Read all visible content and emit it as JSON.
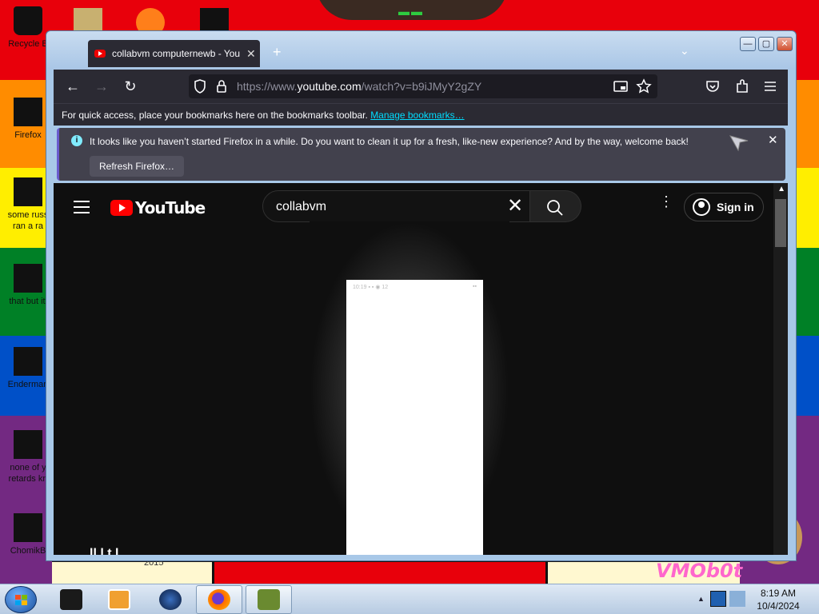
{
  "desktop": {
    "icons": [
      {
        "label": "Recycle B"
      },
      {
        "label": "Firefox"
      },
      {
        "label": "some russ\nran a ra"
      },
      {
        "label": "that but it'"
      },
      {
        "label": "Enderman"
      },
      {
        "label": "none of y\nretards kn"
      },
      {
        "label": "ChomikB"
      }
    ],
    "year_text": "2015",
    "logo_text": "VMOb0t"
  },
  "window": {
    "buttons": {
      "minimize": "—",
      "maximize": "▢",
      "close": "✕"
    },
    "tab": {
      "title": "collabvm computernewb - You",
      "close": "✕"
    },
    "new_tab": "+",
    "tab_list": "⌄"
  },
  "navbar": {
    "back": "←",
    "forward": "→",
    "reload": "↻",
    "url_prefix": "https://www.",
    "url_domain": "youtube.com",
    "url_suffix": "/watch?v=b9iJMyY2gZY",
    "icons": [
      "shield-icon",
      "lock-icon",
      "picture-in-picture-icon",
      "bookmark-star-icon",
      "pocket-icon",
      "extensions-icon",
      "menu-icon"
    ]
  },
  "bookmarks_bar": {
    "text": "For quick access, place your bookmarks here on the bookmarks toolbar. ",
    "link": "Manage bookmarks…"
  },
  "notification": {
    "message": "It looks like you haven’t started Firefox in a while. Do you want to clean it up for a fresh, like-new experience? And by the way, welcome back!",
    "button": "Refresh Firefox…",
    "close": "✕"
  },
  "youtube": {
    "logo_text": "YouTube",
    "search_value": "collabvm",
    "search_clear": "✕",
    "more": "⋮",
    "signin": "Sign in",
    "video_status_left": "10:19 ▪ ▪ ◉ 12",
    "video_status_right": "▪▪",
    "title_peek": "ll  l         t     l"
  },
  "taskbar": {
    "items": [
      "terminal-icon",
      "media-player-icon",
      "browser-globe-icon",
      "firefox-icon",
      "chomikbox-icon"
    ],
    "active_index": 3,
    "clock_time": "8:19 AM",
    "clock_date": "10/4/2024"
  },
  "colors": {
    "firefox_dark": "#2b2a33",
    "youtube_bg": "#0f0f0f",
    "youtube_red": "#ff0000",
    "link": "#00ddff"
  }
}
